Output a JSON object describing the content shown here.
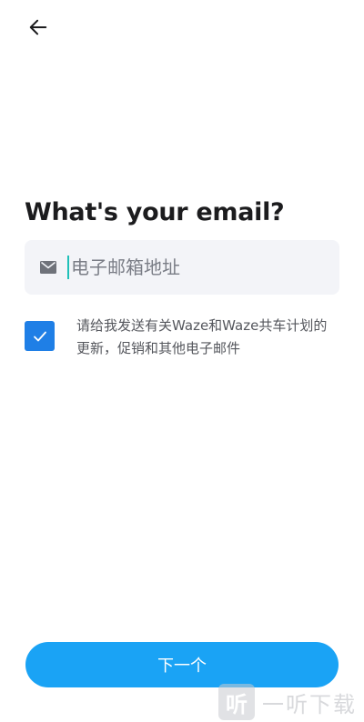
{
  "header": {
    "back_icon": "arrow-left-icon"
  },
  "main": {
    "title": "What's your email?",
    "email": {
      "icon": "mail-icon",
      "placeholder": "电子邮箱地址",
      "value": ""
    },
    "consent": {
      "checked": true,
      "icon": "checkmark-icon",
      "text": "请给我发送有关Waze和Waze共车计划的更新，促销和其他电子邮件"
    },
    "next_label": "下一个"
  },
  "watermark": {
    "logo_glyph": "听",
    "text": "一听下载"
  },
  "colors": {
    "accent": "#1aa3f5",
    "checkbox": "#1f7fe6",
    "caret": "#1fc0b8",
    "field_bg": "#f3f4f8"
  }
}
